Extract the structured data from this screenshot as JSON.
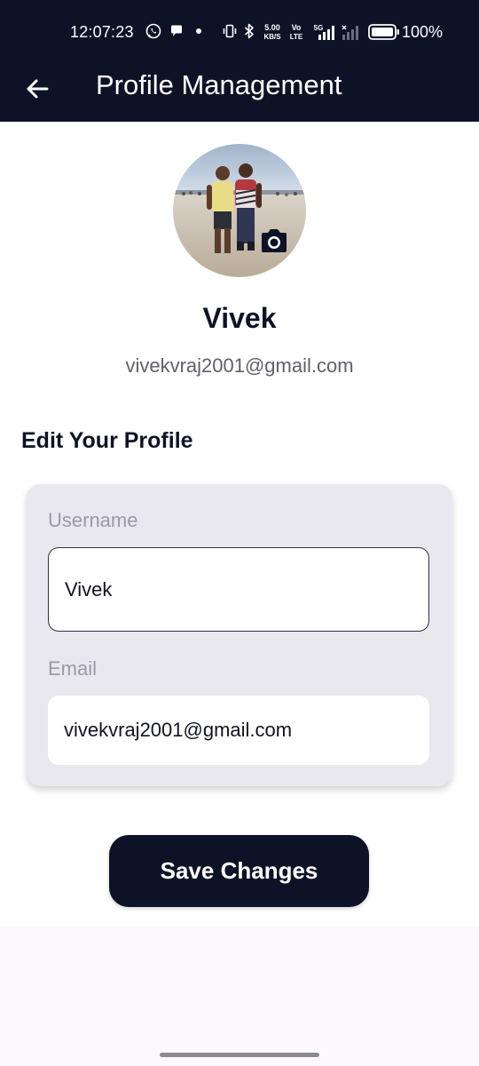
{
  "status_bar": {
    "time": "12:07:23",
    "network_speed_value": "5.00",
    "network_speed_unit": "KB/S",
    "volte_top": "Vo",
    "volte_bottom": "LTE",
    "signal_label": "5G",
    "battery": "100%"
  },
  "app_bar": {
    "title": "Profile Management"
  },
  "profile": {
    "name": "Vivek",
    "email": "vivekvraj2001@gmail.com"
  },
  "form": {
    "section_title": "Edit Your Profile",
    "username_label": "Username",
    "username_value": "Vivek",
    "email_label": "Email",
    "email_value": "vivekvraj2001@gmail.com"
  },
  "actions": {
    "save_label": "Save Changes"
  },
  "colors": {
    "primary": "#0e1226",
    "card_background": "#e8e8ee",
    "page_background": "#fdf8fc"
  }
}
